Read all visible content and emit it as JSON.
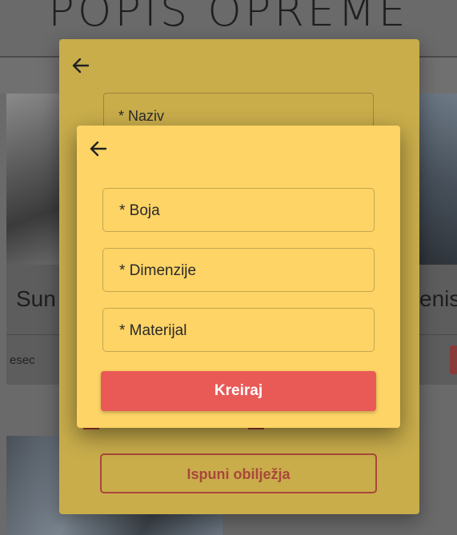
{
  "background": {
    "page_title": "POPIS OPREME",
    "card_left_title": "Sun",
    "card_right_title": "enis",
    "card_left_meta": "esec"
  },
  "outer_modal": {
    "back_icon": "arrow-left-icon",
    "field_label": "* Naziv",
    "fill_button_label": "Ispuni obilježja"
  },
  "inner_modal": {
    "back_icon": "arrow-left-icon",
    "fields": [
      {
        "label": "* Boja"
      },
      {
        "label": "* Dimenzije"
      },
      {
        "label": "* Materijal"
      }
    ],
    "create_button_label": "Kreiraj"
  },
  "colors": {
    "inner_modal_bg": "#fdd465",
    "outer_modal_bg": "#c9ad4b",
    "create_button": "#e95a57",
    "outline_button": "#a8473a"
  }
}
